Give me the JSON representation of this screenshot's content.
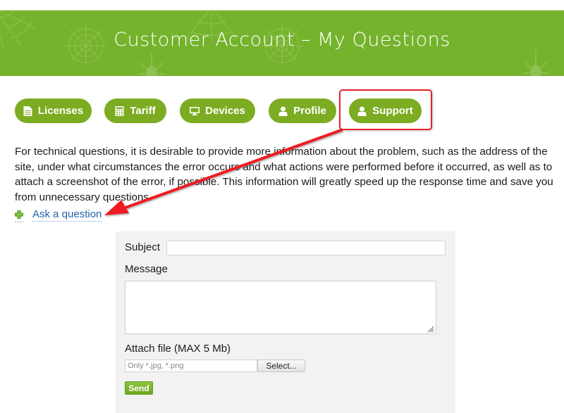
{
  "header": {
    "title": "Customer Account – My Questions",
    "background_color": "#76b32d"
  },
  "nav": {
    "items": [
      {
        "label": "Licenses",
        "icon": "document-icon"
      },
      {
        "label": "Tariff",
        "icon": "calculator-icon"
      },
      {
        "label": "Devices",
        "icon": "monitor-icon"
      },
      {
        "label": "Profile",
        "icon": "user-icon"
      },
      {
        "label": "Support",
        "icon": "user-icon",
        "highlighted": true
      }
    ],
    "button_color": "#7cac22"
  },
  "intro_text": "For technical questions, it is desirable to provide more information about the problem, such as the address of the site, under what circumstances the error occurs and what actions were performed before it occurred, as well as to attach a screenshot of the error, if possible. This information will greatly speed up the response time and save you from unnecessary questions.",
  "ask_link": {
    "label": "Ask a question",
    "icon": "plus-icon"
  },
  "form": {
    "subject_label": "Subject",
    "subject_value": "",
    "message_label": "Message",
    "message_value": "",
    "attach_label": "Attach file (MAX 5 Mb)",
    "file_placeholder": "Only *.jpg, *.png",
    "select_label": "Select...",
    "send_label": "Send"
  },
  "annotation": {
    "color": "#e8222a",
    "description": "red arrow from Support button to Ask a question link"
  }
}
